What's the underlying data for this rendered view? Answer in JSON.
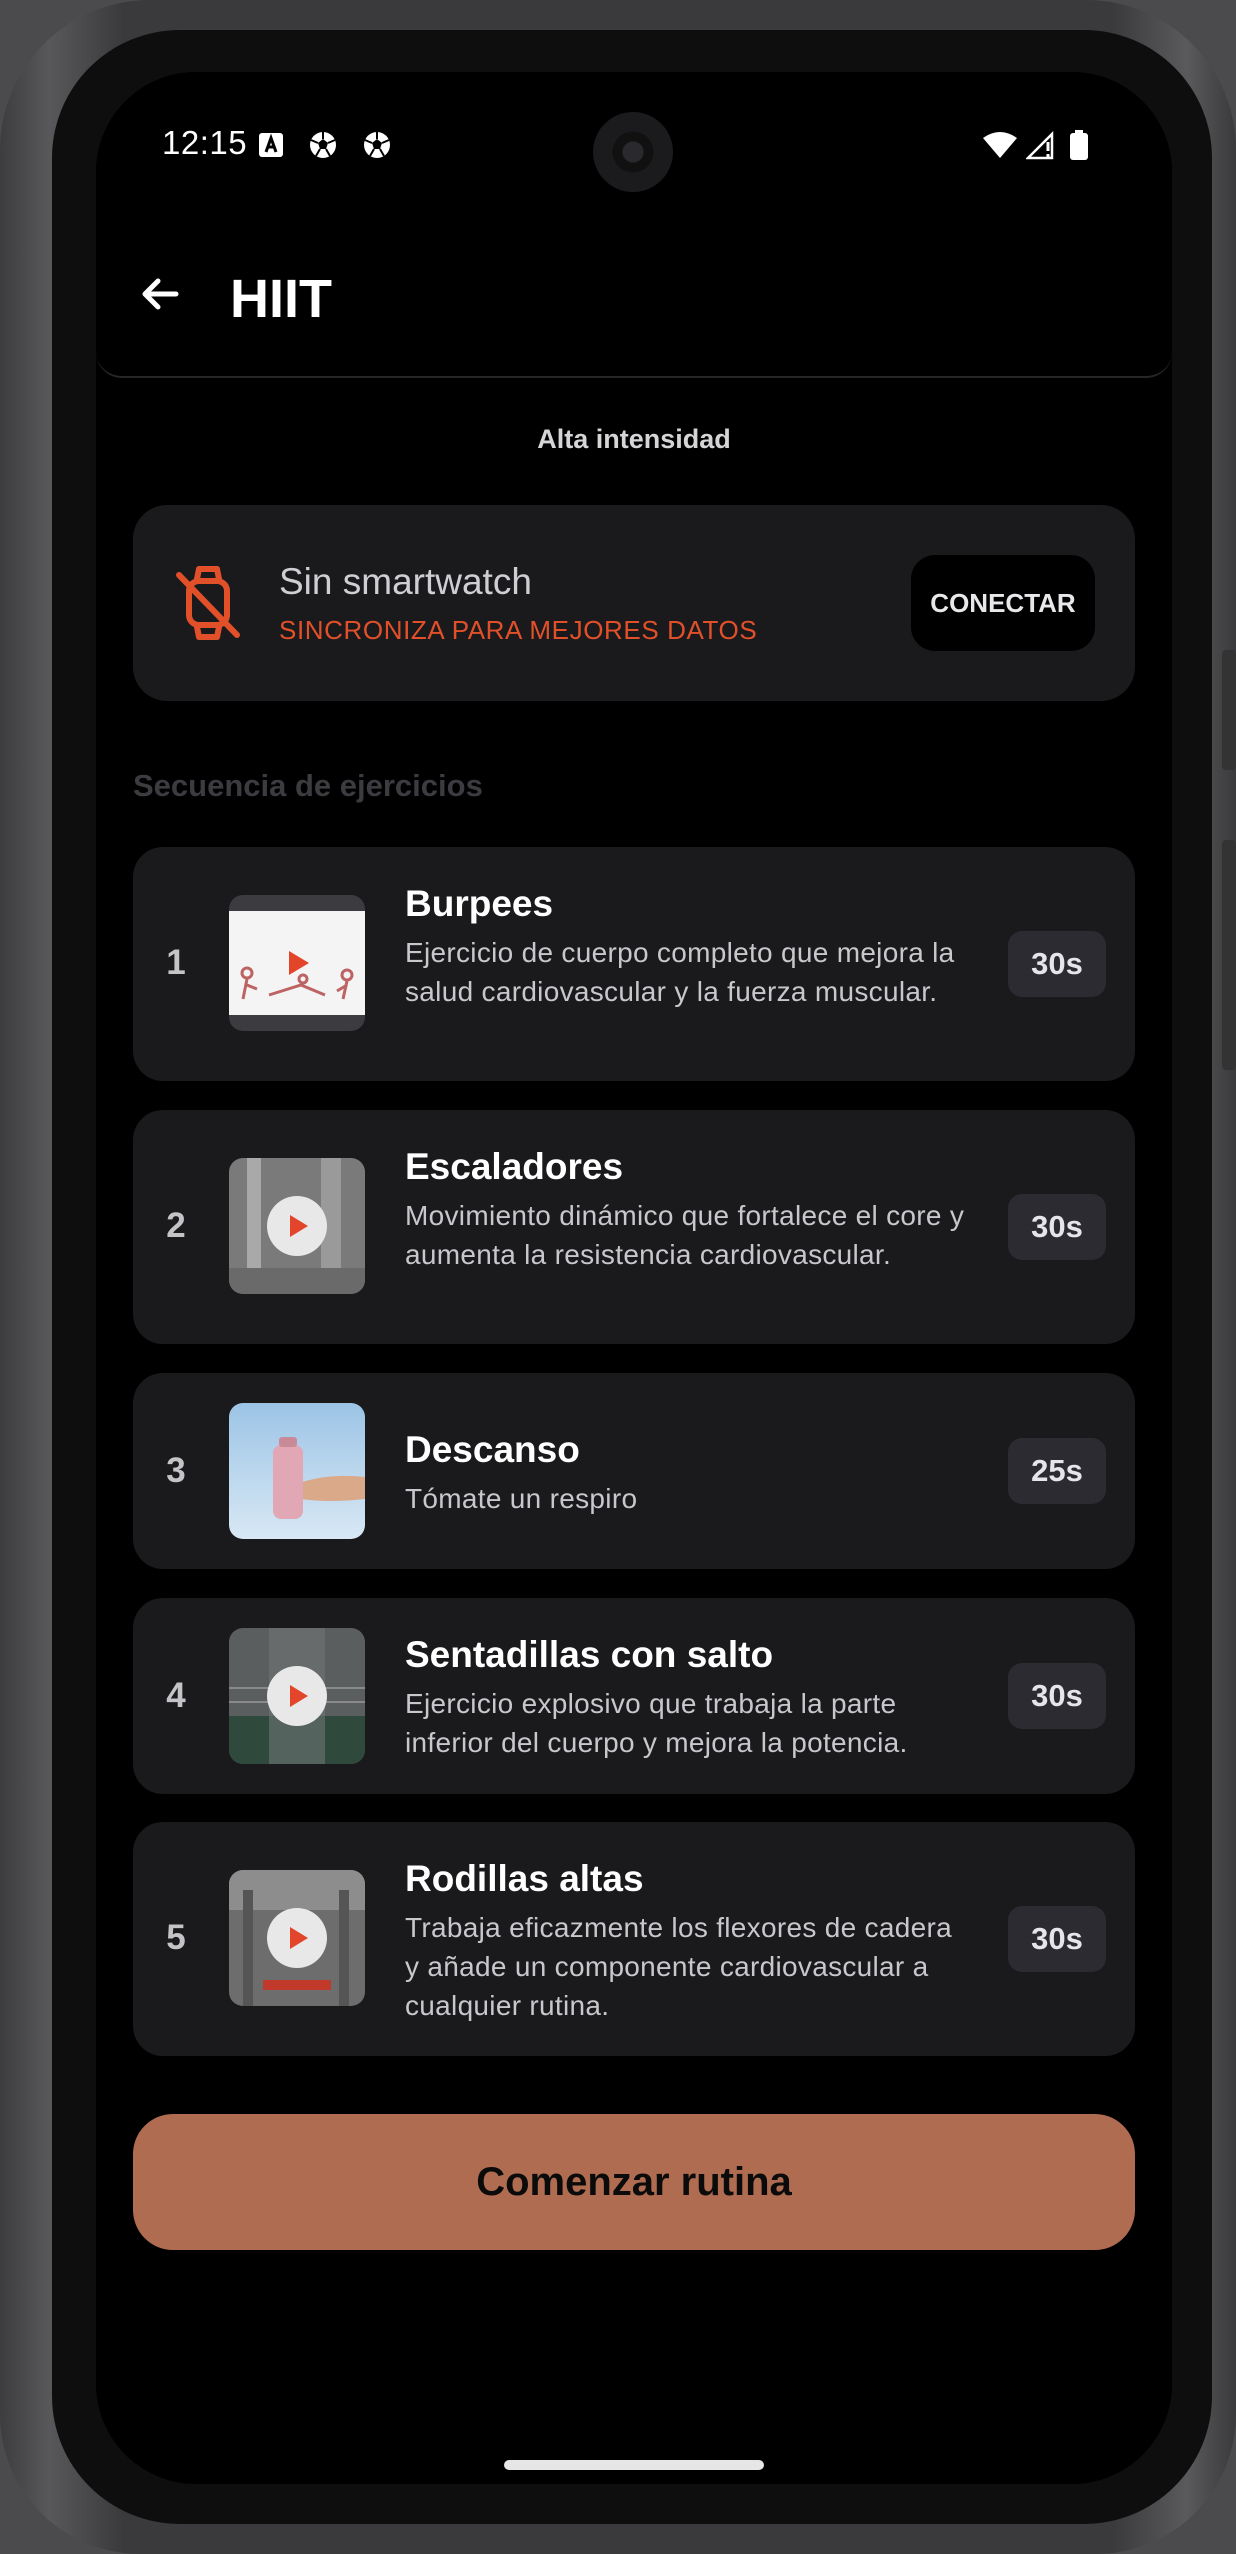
{
  "status_bar": {
    "time": "12:15",
    "icons": [
      "a-box-icon",
      "soccer-ball-icon",
      "soccer-ball-icon",
      "wifi-icon",
      "signal-icon",
      "battery-icon"
    ]
  },
  "app_bar": {
    "back_icon": "arrow-left-icon",
    "title": "HIIT"
  },
  "subtitle": "Alta intensidad",
  "smartwatch": {
    "icon": "watch-off-icon",
    "title": "Sin smartwatch",
    "subtitle": "SINCRONIZA PARA MEJORES DATOS",
    "button": "CONECTAR",
    "accent_color": "#e2502a"
  },
  "section_title": "Secuencia de ejercicios",
  "exercises": [
    {
      "num": "1",
      "name": "Burpees",
      "desc": "Ejercicio de cuerpo completo que mejora la salud cardiovascular y la fuerza muscular.",
      "duration": "30s"
    },
    {
      "num": "2",
      "name": "Escaladores",
      "desc": "Movimiento dinámico que fortalece el core y aumenta la resistencia cardiovascular.",
      "duration": "30s"
    },
    {
      "num": "3",
      "name": "Descanso",
      "desc": "Tómate un respiro",
      "duration": "25s"
    },
    {
      "num": "4",
      "name": "Sentadillas con salto",
      "desc": "Ejercicio explosivo que trabaja la parte inferior del cuerpo y mejora la potencia.",
      "duration": "30s"
    },
    {
      "num": "5",
      "name": "Rodillas altas",
      "desc": "Trabaja eficazmente los flexores de cadera y añade un componente cardiovascular a cualquier rutina.",
      "duration": "30s"
    }
  ],
  "start_button": "Comenzar rutina",
  "colors": {
    "start_button": "#b06c50",
    "card_background": "#1a1a1d",
    "duration_badge": "#2b2b31",
    "play_icon": "#e2452a"
  }
}
